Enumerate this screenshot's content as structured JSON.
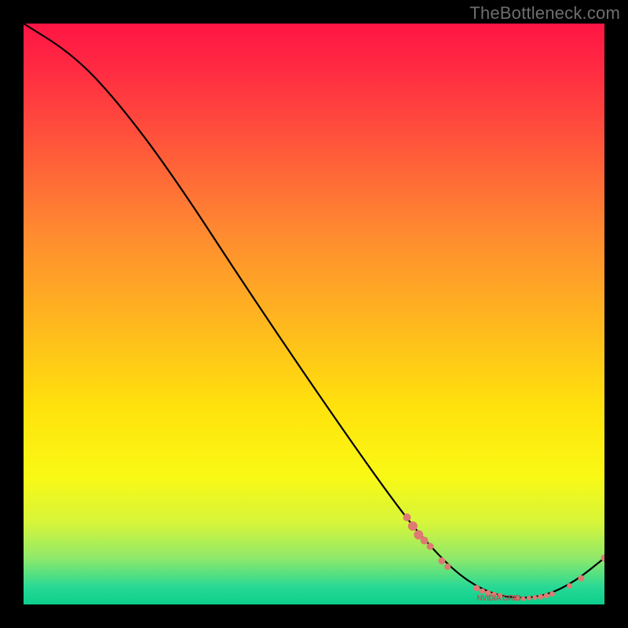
{
  "watermark": "TheBottleneck.com",
  "chart_data": {
    "type": "line",
    "title": "",
    "xlabel": "",
    "ylabel": "",
    "xlim": [
      0,
      100
    ],
    "ylim": [
      0,
      100
    ],
    "curve": {
      "name": "bottleneck-curve",
      "points": [
        {
          "x": 0,
          "y": 100
        },
        {
          "x": 8,
          "y": 95
        },
        {
          "x": 15,
          "y": 88
        },
        {
          "x": 25,
          "y": 75
        },
        {
          "x": 40,
          "y": 52
        },
        {
          "x": 55,
          "y": 30
        },
        {
          "x": 65,
          "y": 16
        },
        {
          "x": 70,
          "y": 10
        },
        {
          "x": 75,
          "y": 5
        },
        {
          "x": 80,
          "y": 2
        },
        {
          "x": 85,
          "y": 1
        },
        {
          "x": 90,
          "y": 1.5
        },
        {
          "x": 95,
          "y": 4
        },
        {
          "x": 100,
          "y": 8
        }
      ]
    },
    "markers": {
      "name": "highlight-markers",
      "color": "#dd7a72",
      "points": [
        {
          "x": 66,
          "y": 15,
          "r": 5
        },
        {
          "x": 67,
          "y": 13.5,
          "r": 6
        },
        {
          "x": 68,
          "y": 12,
          "r": 6
        },
        {
          "x": 69,
          "y": 11,
          "r": 5
        },
        {
          "x": 70,
          "y": 10,
          "r": 4.5
        },
        {
          "x": 72,
          "y": 7.5,
          "r": 4.5
        },
        {
          "x": 73,
          "y": 6.5,
          "r": 4
        },
        {
          "x": 78,
          "y": 2.8,
          "r": 4
        },
        {
          "x": 79,
          "y": 2.3,
          "r": 3.5
        },
        {
          "x": 80,
          "y": 2.0,
          "r": 3.5
        },
        {
          "x": 81,
          "y": 1.7,
          "r": 3.5
        },
        {
          "x": 82,
          "y": 1.5,
          "r": 3.5
        },
        {
          "x": 85,
          "y": 1.0,
          "r": 3
        },
        {
          "x": 86,
          "y": 1.0,
          "r": 3
        },
        {
          "x": 87,
          "y": 1.1,
          "r": 3
        },
        {
          "x": 88,
          "y": 1.2,
          "r": 3
        },
        {
          "x": 89,
          "y": 1.3,
          "r": 3.5
        },
        {
          "x": 90,
          "y": 1.5,
          "r": 3.5
        },
        {
          "x": 91,
          "y": 1.8,
          "r": 3.5
        },
        {
          "x": 94,
          "y": 3.2,
          "r": 3.5
        },
        {
          "x": 96,
          "y": 4.5,
          "r": 4
        },
        {
          "x": 100,
          "y": 8.0,
          "r": 4.5
        }
      ]
    },
    "marker_label": "NVIDIA GRID"
  }
}
